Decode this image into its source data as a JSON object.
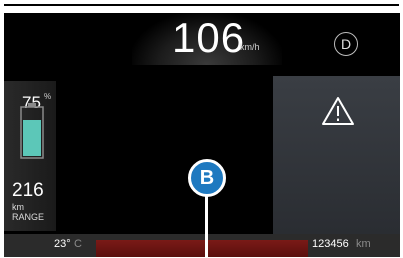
{
  "speedometer": {
    "value": "106",
    "unit": "km/h"
  },
  "gear": {
    "value": "D"
  },
  "battery": {
    "percent": "75",
    "percent_symbol": "%",
    "level": 0.75,
    "fill_color": "#5cc7b8"
  },
  "range": {
    "value": "216",
    "unit": "km",
    "label": "RANGE"
  },
  "warning": {
    "icon": "warning-triangle-icon"
  },
  "status": {
    "temperature_value": "23°",
    "temperature_unit": "C",
    "odometer_value": "123456",
    "odometer_unit": "km"
  },
  "callout": {
    "label": "B",
    "color": "#1e79c0"
  }
}
